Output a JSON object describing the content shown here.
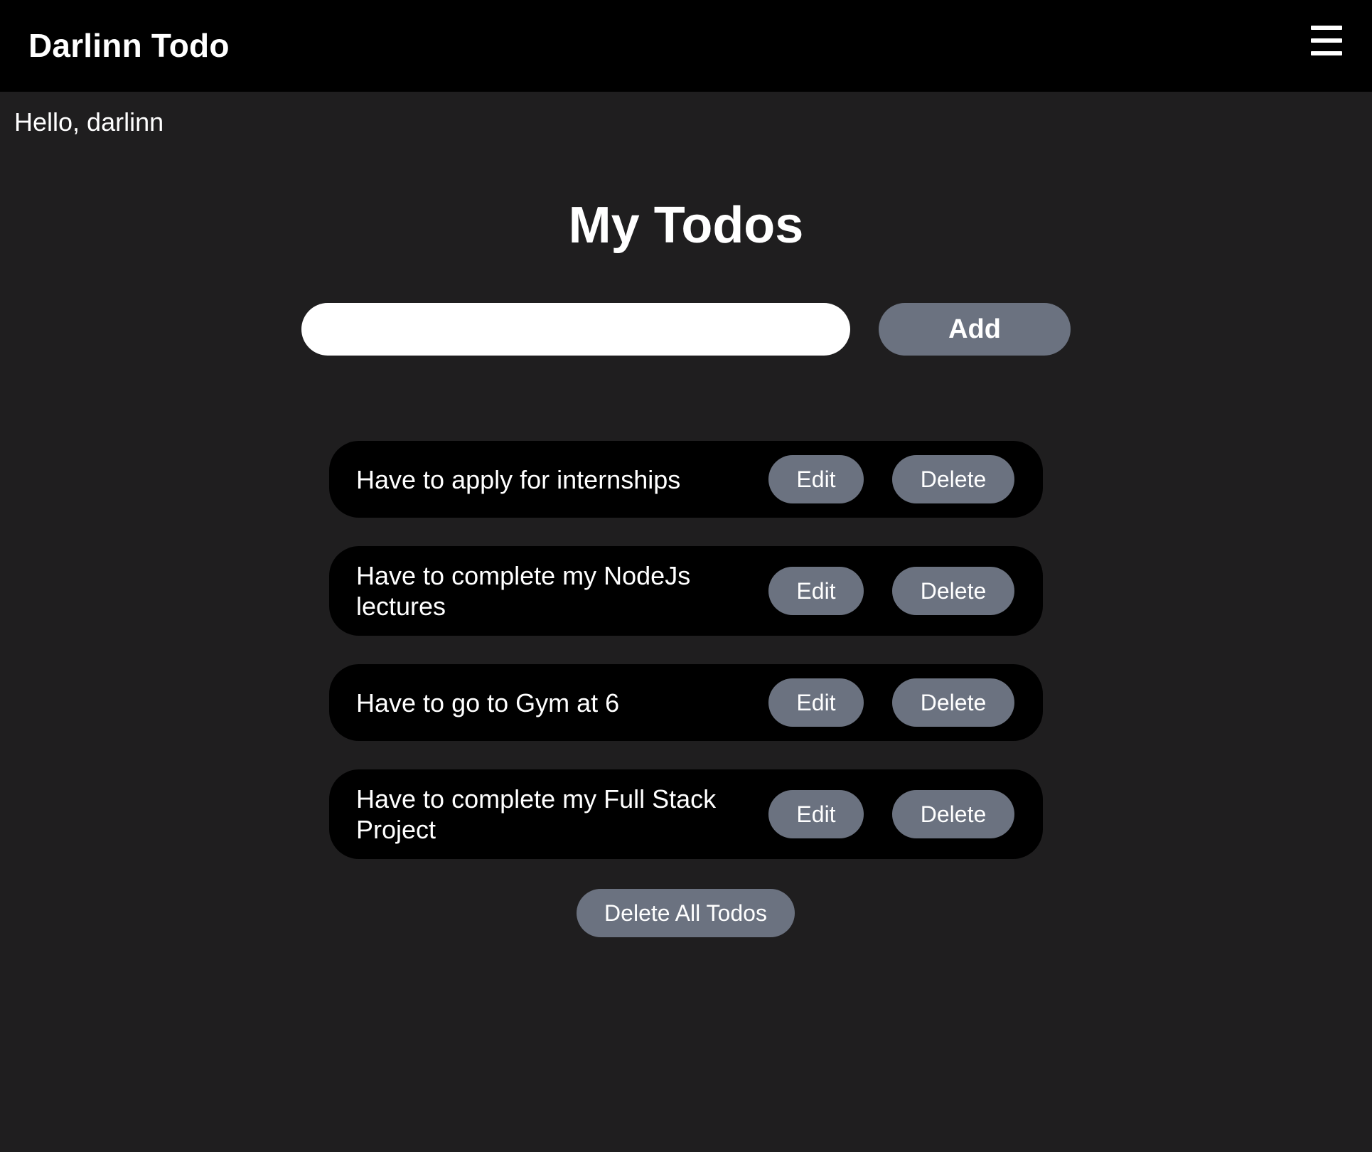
{
  "header": {
    "brand": "Darlinn Todo",
    "menu_icon": "hamburger-menu-icon"
  },
  "greeting": "Hello, darlinn",
  "main": {
    "title": "My Todos",
    "input": {
      "value": "",
      "placeholder": ""
    },
    "add_label": "Add",
    "todos": [
      {
        "text": "Have to apply for internships",
        "edit_label": "Edit",
        "delete_label": "Delete"
      },
      {
        "text": "Have to complete my NodeJs lectures",
        "edit_label": "Edit",
        "delete_label": "Delete"
      },
      {
        "text": "Have to go to Gym at 6",
        "edit_label": "Edit",
        "delete_label": "Delete"
      },
      {
        "text": "Have to complete my Full Stack Project",
        "edit_label": "Edit",
        "delete_label": "Delete"
      }
    ],
    "delete_all_label": "Delete All Todos"
  },
  "colors": {
    "background": "#1f1e1f",
    "navbar": "#000000",
    "card": "#000000",
    "button": "#6b7280",
    "text": "#ffffff"
  }
}
